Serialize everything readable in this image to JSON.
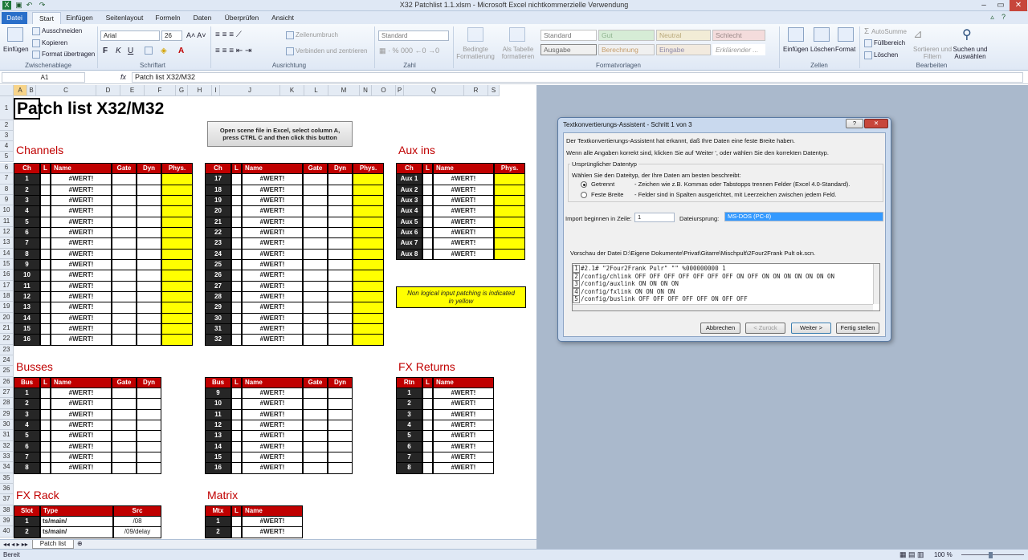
{
  "window": {
    "title": "X32 Patchlist 1.1.xlsm  -  Microsoft Excel nichtkommerzielle Verwendung",
    "min": "–",
    "max": "▭",
    "close": "✕"
  },
  "tabs": [
    "Datei",
    "Start",
    "Einfügen",
    "Seitenlayout",
    "Formeln",
    "Daten",
    "Überprüfen",
    "Ansicht"
  ],
  "ribbon": {
    "paste": "Einfügen",
    "cut": "Ausschneiden",
    "copy": "Kopieren",
    "format_painter": "Format übertragen",
    "clipboard": "Zwischenablage",
    "font_name": "Arial",
    "font_size": "26",
    "font_group": "Schriftart",
    "wrap": "Zeilenumbruch",
    "merge": "Verbinden und zentrieren",
    "align_group": "Ausrichtung",
    "number_format": "Standard",
    "number_group": "Zahl",
    "cond_format": "Bedingte Formatierung",
    "as_table": "Als Tabelle formatieren",
    "styles": [
      "Standard",
      "Gut",
      "Neutral",
      "Schlecht",
      "Ausgabe",
      "Berechnung",
      "Eingabe",
      "Erklärender ..."
    ],
    "styles_group": "Formatvorlagen",
    "insert": "Einfügen",
    "delete": "Löschen",
    "format": "Format",
    "cells_group": "Zellen",
    "autosum": "AutoSumme",
    "fill": "Füllbereich",
    "clear": "Löschen",
    "sort": "Sortieren und Filtern",
    "find": "Suchen und Auswählen",
    "edit_group": "Bearbeiten"
  },
  "formula_bar": {
    "cell_ref": "A1",
    "fx": "fx",
    "content": "Patch list X32/M32"
  },
  "columns": [
    "A",
    "B",
    "C",
    "D",
    "E",
    "F",
    "G",
    "H",
    "I",
    "J",
    "K",
    "L",
    "M",
    "N",
    "O",
    "P",
    "Q",
    "R",
    "S"
  ],
  "rows": [
    "1",
    "2",
    "3",
    "4",
    "5",
    "6",
    "7",
    "8",
    "9",
    "10",
    "11",
    "12",
    "13",
    "14",
    "15",
    "16",
    "17",
    "18",
    "19",
    "20",
    "21",
    "22",
    "23",
    "24",
    "25",
    "26",
    "27",
    "28",
    "29",
    "30",
    "31",
    "32",
    "33",
    "34",
    "35",
    "36",
    "37",
    "38",
    "39",
    "40"
  ],
  "sheet": {
    "title": "Patch list X32/M32",
    "macro_button": "Open scene file in Excel, select column A, press CTRL C and then click this button",
    "channels": "Channels",
    "aux_ins": "Aux ins",
    "busses": "Busses",
    "fx_returns": "FX Returns",
    "fx_rack": "FX Rack",
    "matrix": "Matrix",
    "note": "Non logical input patching is indicated in yellow",
    "hdr_ch": "Ch",
    "hdr_l": "L",
    "hdr_name": "Name",
    "hdr_gate": "Gate",
    "hdr_dyn": "Dyn",
    "hdr_phys": "Phys.",
    "hdr_bus": "Bus",
    "hdr_rtn": "Rtn",
    "hdr_slot": "Slot",
    "hdr_type": "Type",
    "hdr_src": "Src",
    "hdr_mtx": "Mtx",
    "err": "#WERT!",
    "ch1": [
      "1",
      "2",
      "3",
      "4",
      "5",
      "6",
      "7",
      "8",
      "9",
      "10",
      "11",
      "12",
      "13",
      "14",
      "15",
      "16"
    ],
    "ch2": [
      "17",
      "18",
      "19",
      "20",
      "21",
      "22",
      "23",
      "24",
      "25",
      "26",
      "27",
      "28",
      "29",
      "30",
      "31",
      "32"
    ],
    "aux": [
      "Aux 1",
      "Aux 2",
      "Aux 3",
      "Aux 4",
      "Aux 5",
      "Aux 6",
      "Aux 7",
      "Aux 8"
    ],
    "bus1": [
      "1",
      "2",
      "3",
      "4",
      "5",
      "6",
      "7",
      "8"
    ],
    "bus2": [
      "9",
      "10",
      "11",
      "12",
      "13",
      "14",
      "15",
      "16"
    ],
    "rtn": [
      "1",
      "2",
      "3",
      "4",
      "5",
      "6",
      "7",
      "8"
    ],
    "fx": [
      {
        "slot": "1",
        "type": "ts/main/",
        "src": "/08"
      },
      {
        "slot": "2",
        "type": "ts/main/",
        "src": "/09/delay"
      }
    ],
    "mtx": [
      "1",
      "2"
    ]
  },
  "sheet_tab": "Patch list",
  "status": {
    "ready": "Bereit",
    "zoom": "100 %"
  },
  "dialog": {
    "title": "Textkonvertierungs-Assistent - Schritt 1 von 3",
    "help": "?",
    "close": "✕",
    "intro1": "Der Textkonvertierungs-Assistent hat erkannt, daß Ihre Daten eine feste Breite haben.",
    "intro2": "Wenn alle Angaben korrekt sind, klicken Sie auf 'Weiter ', oder wählen Sie den korrekten Datentyp.",
    "group": "Ursprünglicher Datentyp",
    "choose": "Wählen Sie den Dateityp, der Ihre Daten am besten beschreibt:",
    "opt1": "Getrennt",
    "opt1_desc": "- Zeichen wie z.B. Kommas oder Tabstopps trennen Felder (Excel 4.0-Standard).",
    "opt2": "Feste Breite",
    "opt2_desc": "- Felder sind in Spalten ausgerichtet, mit Leerzeichen zwischen jedem Feld.",
    "import_label": "Import beginnen in Zeile:",
    "import_value": "1",
    "origin_label": "Dateiursprung:",
    "origin_value": "MS-DOS (PC-8)",
    "preview_label": "Vorschau der Datei D:\\Eigene Dokumente\\Privat\\Gitarre\\Mischpult\\2Four2Frank Pult ok.scn.",
    "preview": [
      {
        "n": "1",
        "t": "#2.1# \"2Four2Frank Pulr\" \"\" %000000000 1"
      },
      {
        "n": "2",
        "t": "/config/chlink OFF OFF OFF OFF OFF OFF OFF ON OFF ON ON ON ON ON ON ON"
      },
      {
        "n": "3",
        "t": "/config/auxlink ON ON ON ON"
      },
      {
        "n": "4",
        "t": "/config/fxlink ON ON ON ON"
      },
      {
        "n": "5",
        "t": "/config/buslink OFF OFF OFF OFF OFF ON OFF OFF"
      }
    ],
    "cancel": "Abbrechen",
    "back": "< Zurück",
    "next": "Weiter >",
    "finish": "Fertig stellen"
  }
}
